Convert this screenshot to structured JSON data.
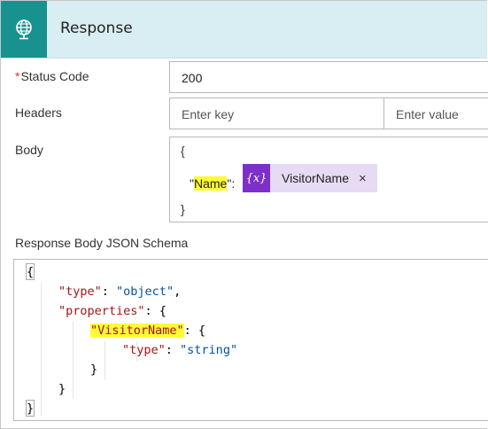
{
  "header": {
    "title": "Response",
    "icon": "globe-icon",
    "color": "#19918f"
  },
  "status_code": {
    "label": "Status Code",
    "required_mark": "*",
    "value": "200"
  },
  "headers": {
    "label": "Headers",
    "key_placeholder": "Enter key",
    "value_placeholder": "Enter value"
  },
  "body": {
    "label": "Body",
    "open_brace": "{",
    "close_brace": "}",
    "key_quote_open": "\"",
    "key": "Name",
    "key_quote_close": "\":",
    "token": {
      "icon": "{x}",
      "label": "VisitorName",
      "remove": "×"
    }
  },
  "schema": {
    "label": "Response Body JSON Schema",
    "lines": {
      "l1": "{",
      "l2_key": "\"type\"",
      "l2_colon": ": ",
      "l2_val": "\"object\"",
      "l2_comma": ",",
      "l3_key": "\"properties\"",
      "l3_rest": ": {",
      "l4_key": "\"VisitorName\"",
      "l4_rest": ": {",
      "l5_key": "\"type\"",
      "l5_colon": ": ",
      "l5_val": "\"string\"",
      "l6": "}",
      "l7": "}",
      "l8": "}"
    }
  }
}
